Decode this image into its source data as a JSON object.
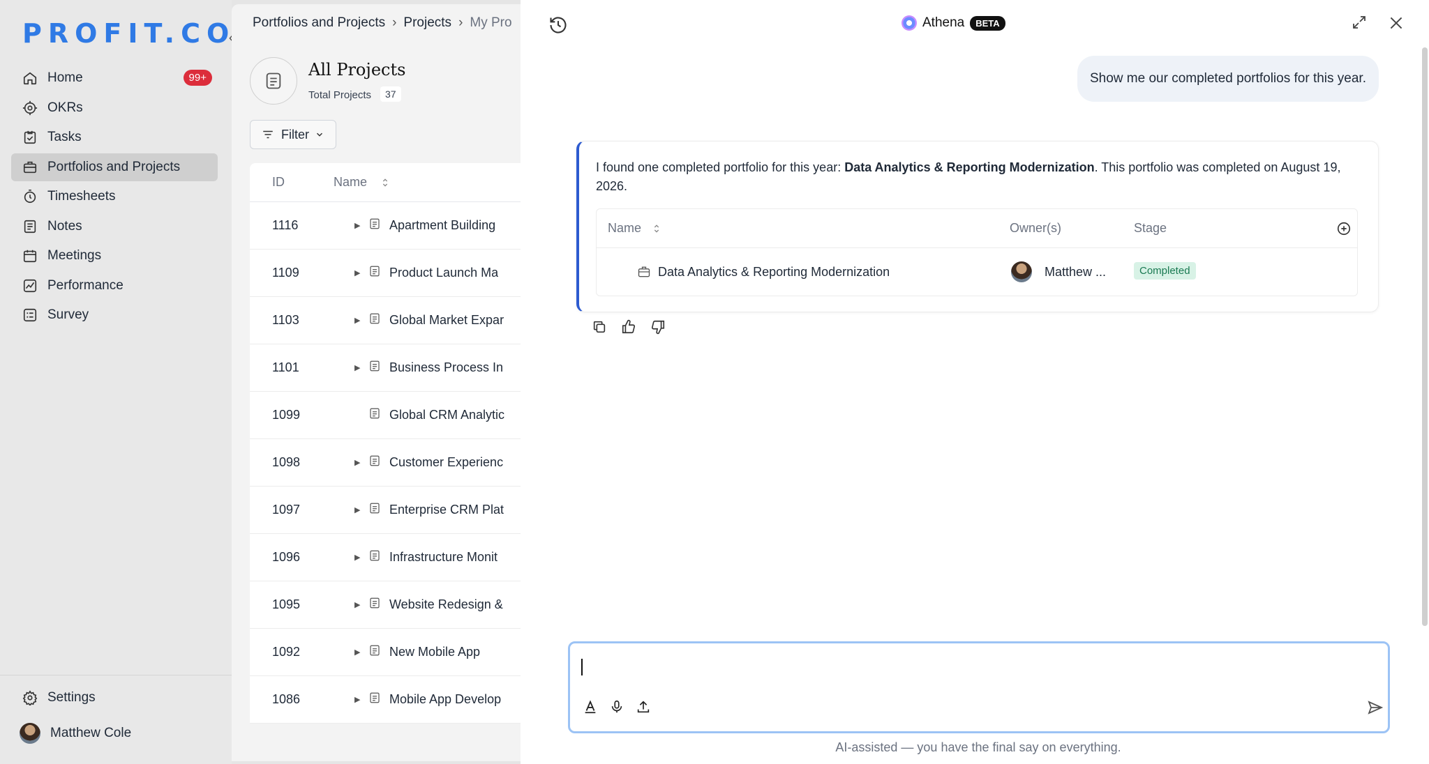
{
  "sidebar": {
    "logo": "PROFIT.CO",
    "items": [
      {
        "label": "Home",
        "icon": "home-icon",
        "badge": "99+"
      },
      {
        "label": "OKRs",
        "icon": "target-icon"
      },
      {
        "label": "Tasks",
        "icon": "tasks-icon"
      },
      {
        "label": "Portfolios and Projects",
        "icon": "briefcase-icon",
        "active": true
      },
      {
        "label": "Timesheets",
        "icon": "stopwatch-icon"
      },
      {
        "label": "Notes",
        "icon": "notes-icon"
      },
      {
        "label": "Meetings",
        "icon": "calendar-icon"
      },
      {
        "label": "Performance",
        "icon": "chart-icon"
      },
      {
        "label": "Survey",
        "icon": "survey-icon"
      }
    ],
    "settings_label": "Settings",
    "user_name": "Matthew Cole"
  },
  "main": {
    "breadcrumb": [
      "Portfolios and Projects",
      "Projects",
      "My Pro"
    ],
    "title": "All Projects",
    "total_label": "Total Projects",
    "total_count": "37",
    "filter_label": "Filter",
    "columns": {
      "id": "ID",
      "name": "Name"
    },
    "rows": [
      {
        "id": "1116",
        "name": "Apartment Building",
        "expandable": true
      },
      {
        "id": "1109",
        "name": "Product Launch Ma",
        "expandable": true
      },
      {
        "id": "1103",
        "name": "Global Market Expar",
        "expandable": true
      },
      {
        "id": "1101",
        "name": "Business Process In",
        "expandable": true
      },
      {
        "id": "1099",
        "name": "Global CRM Analytic",
        "expandable": false
      },
      {
        "id": "1098",
        "name": "Customer Experienc",
        "expandable": true
      },
      {
        "id": "1097",
        "name": "Enterprise CRM Plat",
        "expandable": true
      },
      {
        "id": "1096",
        "name": "Infrastructure Monit",
        "expandable": true
      },
      {
        "id": "1095",
        "name": "Website Redesign &",
        "expandable": true
      },
      {
        "id": "1092",
        "name": "New Mobile App",
        "expandable": true
      },
      {
        "id": "1086",
        "name": "Mobile App Develop",
        "expandable": true
      }
    ]
  },
  "chat": {
    "title": "Athena",
    "badge": "BETA",
    "user_message": "Show me our completed portfolios for this year.",
    "ai_text_prefix": "I found one completed portfolio for this year: ",
    "ai_text_bold": "Data Analytics & Reporting Modernization",
    "ai_text_suffix": ". This portfolio was completed on August 19, 2026.",
    "result_table": {
      "columns": {
        "name": "Name",
        "owner": "Owner(s)",
        "stage": "Stage"
      },
      "row": {
        "name": "Data Analytics & Reporting Modernization",
        "owner": "Matthew ...",
        "stage": "Completed"
      }
    },
    "input_value": "",
    "disclaimer": "AI-assisted — you have the final say on everything.",
    "colors": {
      "accent": "#2d5bd0",
      "completed_bg": "#d8f2e6",
      "completed_text": "#1a7a52",
      "badge_red": "#dc2d3b",
      "logo_blue": "#2f7ae5"
    }
  }
}
